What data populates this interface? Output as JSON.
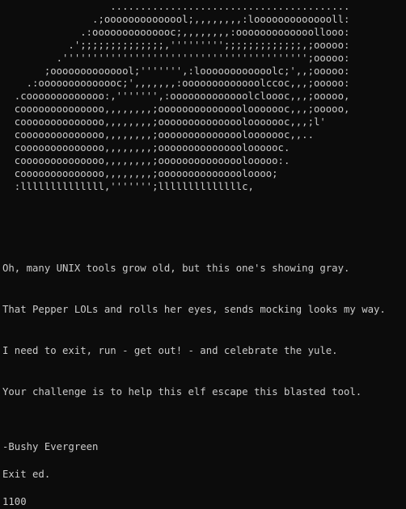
{
  "terminal": {
    "ascii_art": "                  ........................................\n               .;oooooooooooool;,,,,,,,,:loooooooooooooll:\n             .:oooooooooooooc;,,,,,,,,:ooooooooooooollooo:\n           .';;;;;;;;;;;;;;,''''''''';;;;;;;;;;;;;,;ooooo:\n         .''''''''''''''''''''''''''''''''''''''''';ooooo:\n       ;oooooooooooool;''''''',:loooooooooooolc;',,;ooooo:\n    .:oooooooooooooc;',,,,,,,:ooooooooooooolccoc,,,;ooooo:\n  .cooooooooooooo:,''''''',:ooooooooooooolcloooc,,,;ooooo,\n  coooooooooooooo,,,,,,,,;oooooooooooooolooooooc,,,;ooooo,\n  coooooooooooooo,,,,,,,,;oooooooooooooolooooooc,,,;l'\n  coooooooooooooo,,,,,,,,;oooooooooooooolooooooc,,..\n  coooooooooooooo,,,,,,,,;ooooooooooooooloooooc.\n  coooooooooooooo,,,,,,,,;oooooooooooooolooooo:.\n  coooooooooooooo,,,,,,,,;ooooooooooooooloooo;\n  :llllllllllllll,''''''';llllllllllllllc,",
    "poem_lines": [
      "Oh, many UNIX tools grow old, but this one's showing gray.",
      "That Pepper LOLs and rolls her eyes, sends mocking looks my way.",
      "I need to exit, run - get out! - and celebrate the yule.",
      "Your challenge is to help this elf escape this blasted tool."
    ],
    "signature": "-Bushy Evergreen",
    "exit_line": "Exit ed.",
    "count_line": "1100"
  }
}
